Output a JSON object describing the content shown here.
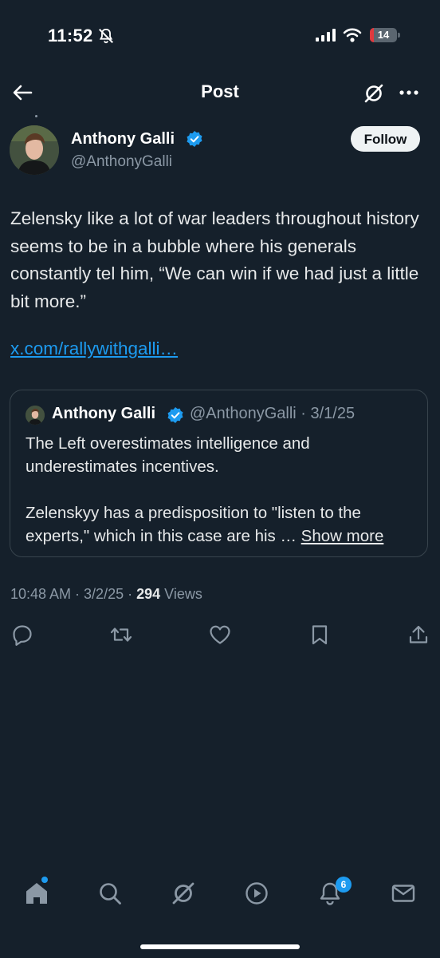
{
  "status_bar": {
    "time": "11:52",
    "battery_level": "14",
    "battery_fraction": 0.14,
    "icons": [
      "bell-muted-icon",
      "signal-icon",
      "wifi-icon",
      "battery-icon"
    ]
  },
  "header": {
    "title": "Post",
    "icons": [
      "back-arrow-icon",
      "grok-icon",
      "more-icon"
    ]
  },
  "tweet": {
    "author_name": "Anthony Galli",
    "author_handle": "@AnthonyGalli",
    "follow_label": "Follow",
    "text": "Zelensky like a lot of war leaders throughout history seems to be in a bubble where his generals constantly tel him, “We can win if we had just a little bit more.”",
    "link": "x.com/rallywithgalli…",
    "timestamp": "10:48 AM · 3/2/25 · ",
    "views_count": "294",
    "views_label": " Views"
  },
  "quote": {
    "author_name": "Anthony Galli",
    "meta": "@AnthonyGalli · 3/1/25",
    "text": "The Left overestimates intelligence and underestimates incentives.\n\nZelenskyy has a predisposition to \"listen to the experts,\" which in this case are his … ",
    "show_more": "Show more"
  },
  "actions": [
    "reply-icon",
    "repost-icon",
    "like-icon",
    "bookmark-icon",
    "share-icon"
  ],
  "bottom_nav": {
    "items": [
      "home-icon",
      "search-icon",
      "grok-icon",
      "video-icon",
      "notifications-icon",
      "messages-icon"
    ],
    "notifications_badge": "6"
  },
  "colors": {
    "background": "#15202b",
    "accent": "#1d9bf0",
    "muted_text": "#8b98a5",
    "border": "#38444d"
  }
}
